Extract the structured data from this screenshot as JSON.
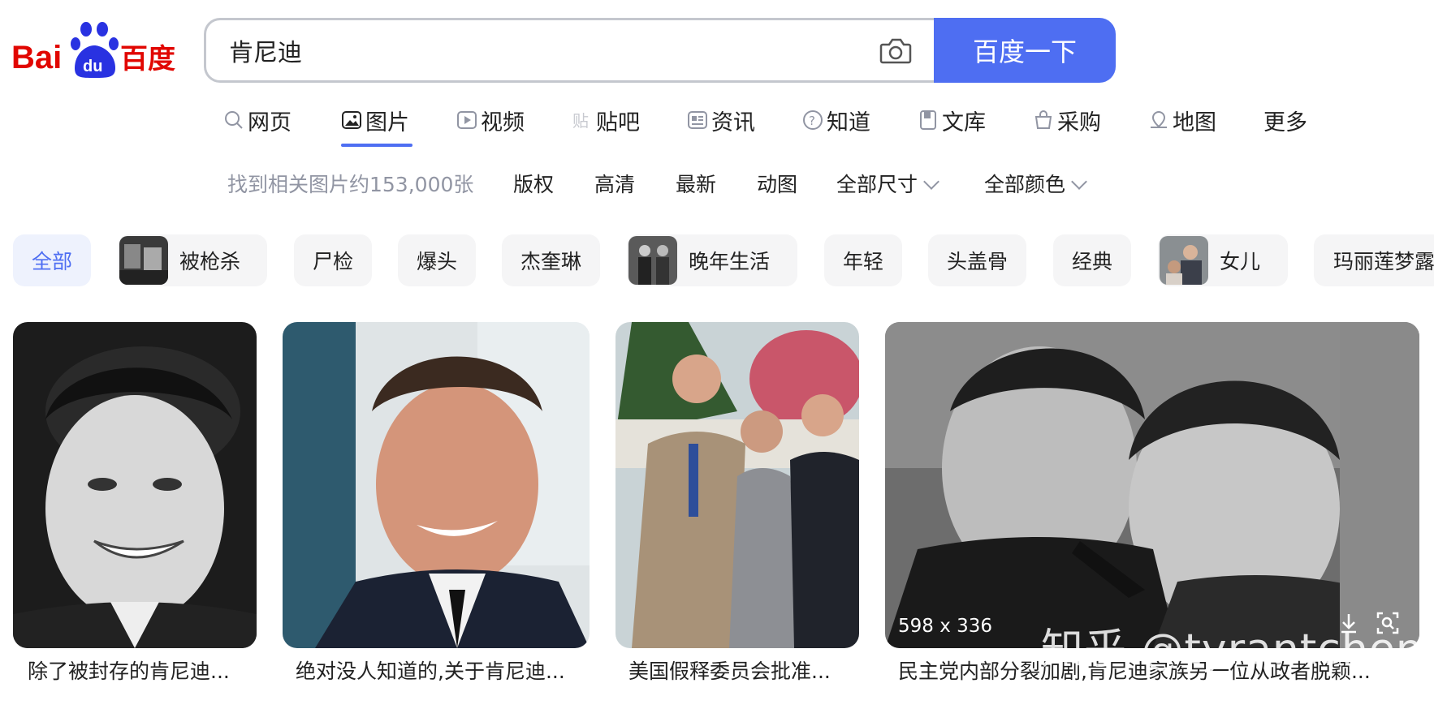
{
  "logo": {
    "text_left": "Bai",
    "text_paw": "du",
    "text_right": "百度",
    "alt": "Baidu"
  },
  "search": {
    "query": "肯尼迪",
    "button_label": "百度一下"
  },
  "tabs": [
    {
      "label": "网页",
      "icon": "search-icon"
    },
    {
      "label": "图片",
      "icon": "image-icon",
      "active": true
    },
    {
      "label": "视频",
      "icon": "video-icon"
    },
    {
      "label": "贴吧",
      "icon": "tieba-icon"
    },
    {
      "label": "资讯",
      "icon": "news-icon"
    },
    {
      "label": "知道",
      "icon": "question-icon"
    },
    {
      "label": "文库",
      "icon": "document-icon"
    },
    {
      "label": "采购",
      "icon": "shopping-bag-icon"
    },
    {
      "label": "地图",
      "icon": "map-icon"
    },
    {
      "label": "更多",
      "icon": ""
    }
  ],
  "filters": {
    "result_count": "找到相关图片约153,000张",
    "copyright": "版权",
    "hd": "高清",
    "latest": "最新",
    "animated": "动图",
    "size": "全部尺寸",
    "color": "全部颜色"
  },
  "chips": [
    {
      "label": "全部",
      "active": true
    },
    {
      "label": "被枪杀",
      "thumb": true
    },
    {
      "label": "尸检"
    },
    {
      "label": "爆头"
    },
    {
      "label": "杰奎琳"
    },
    {
      "label": "晚年生活",
      "thumb": true
    },
    {
      "label": "年轻"
    },
    {
      "label": "头盖骨"
    },
    {
      "label": "经典"
    },
    {
      "label": "女儿",
      "thumb": true
    },
    {
      "label": "玛丽莲梦露"
    }
  ],
  "results": [
    {
      "caption": "除了被封存的肯尼迪..."
    },
    {
      "caption": "绝对没人知道的,关于肯尼迪..."
    },
    {
      "caption": "美国假释委员会批准..."
    },
    {
      "caption": "民主党内部分裂加剧,肯尼迪家族另一位从政者脱颖...",
      "dims": "598 x 336"
    }
  ],
  "watermark": "知乎 @tyrantchen",
  "colors": {
    "brand_blue": "#4e6ef2",
    "logo_red": "#e10601",
    "logo_blue": "#2932e1",
    "muted": "#9195a3"
  }
}
